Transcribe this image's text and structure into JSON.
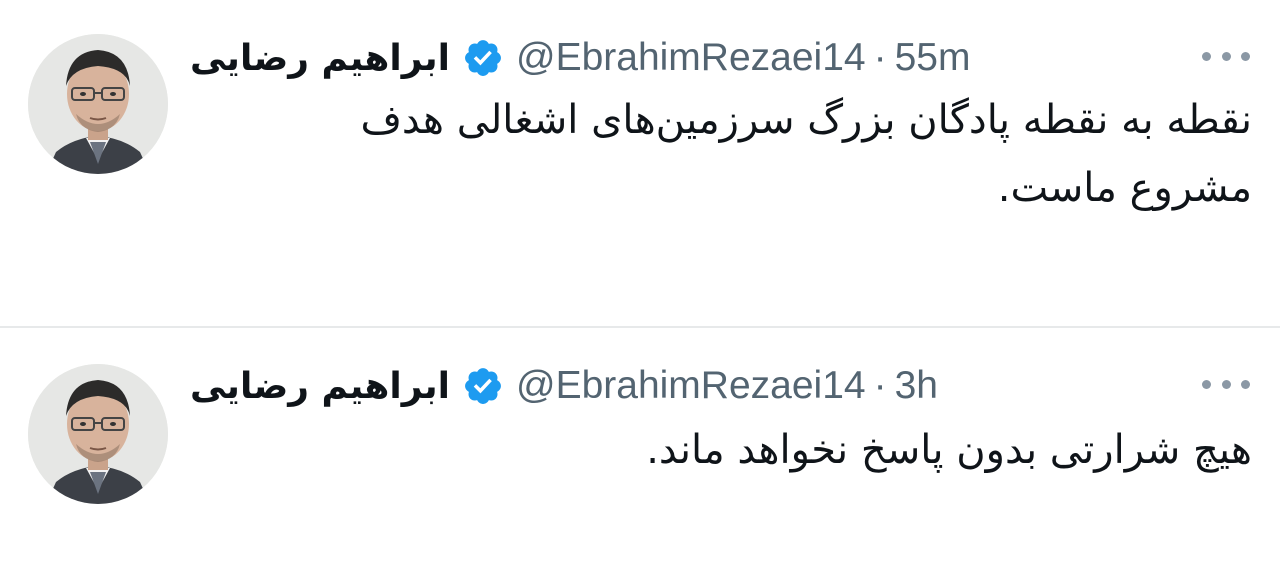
{
  "tweets": [
    {
      "display_name": "ابراهیم رضایی",
      "verified_icon": "verified-badge-icon",
      "handle": "@EbrahimRezaei14",
      "separator": "·",
      "time": "55m",
      "text_lines": [
        "نقطه به نقطه پادگان بزرگ سرزمین‌های اشغالی هدف",
        "مشروع ماست."
      ],
      "more_icon": "more-options-icon"
    },
    {
      "display_name": "ابراهیم رضایی",
      "verified_icon": "verified-badge-icon",
      "handle": "@EbrahimRezaei14",
      "separator": "·",
      "time": "3h",
      "text_lines": [
        "هیچ شرارتی بدون پاسخ نخواهد ماند."
      ],
      "more_icon": "more-options-icon"
    }
  ],
  "colors": {
    "text_primary": "#0f1419",
    "text_secondary": "#536471",
    "verified_blue": "#1d9bf0",
    "divider": "#e7e9ea"
  }
}
